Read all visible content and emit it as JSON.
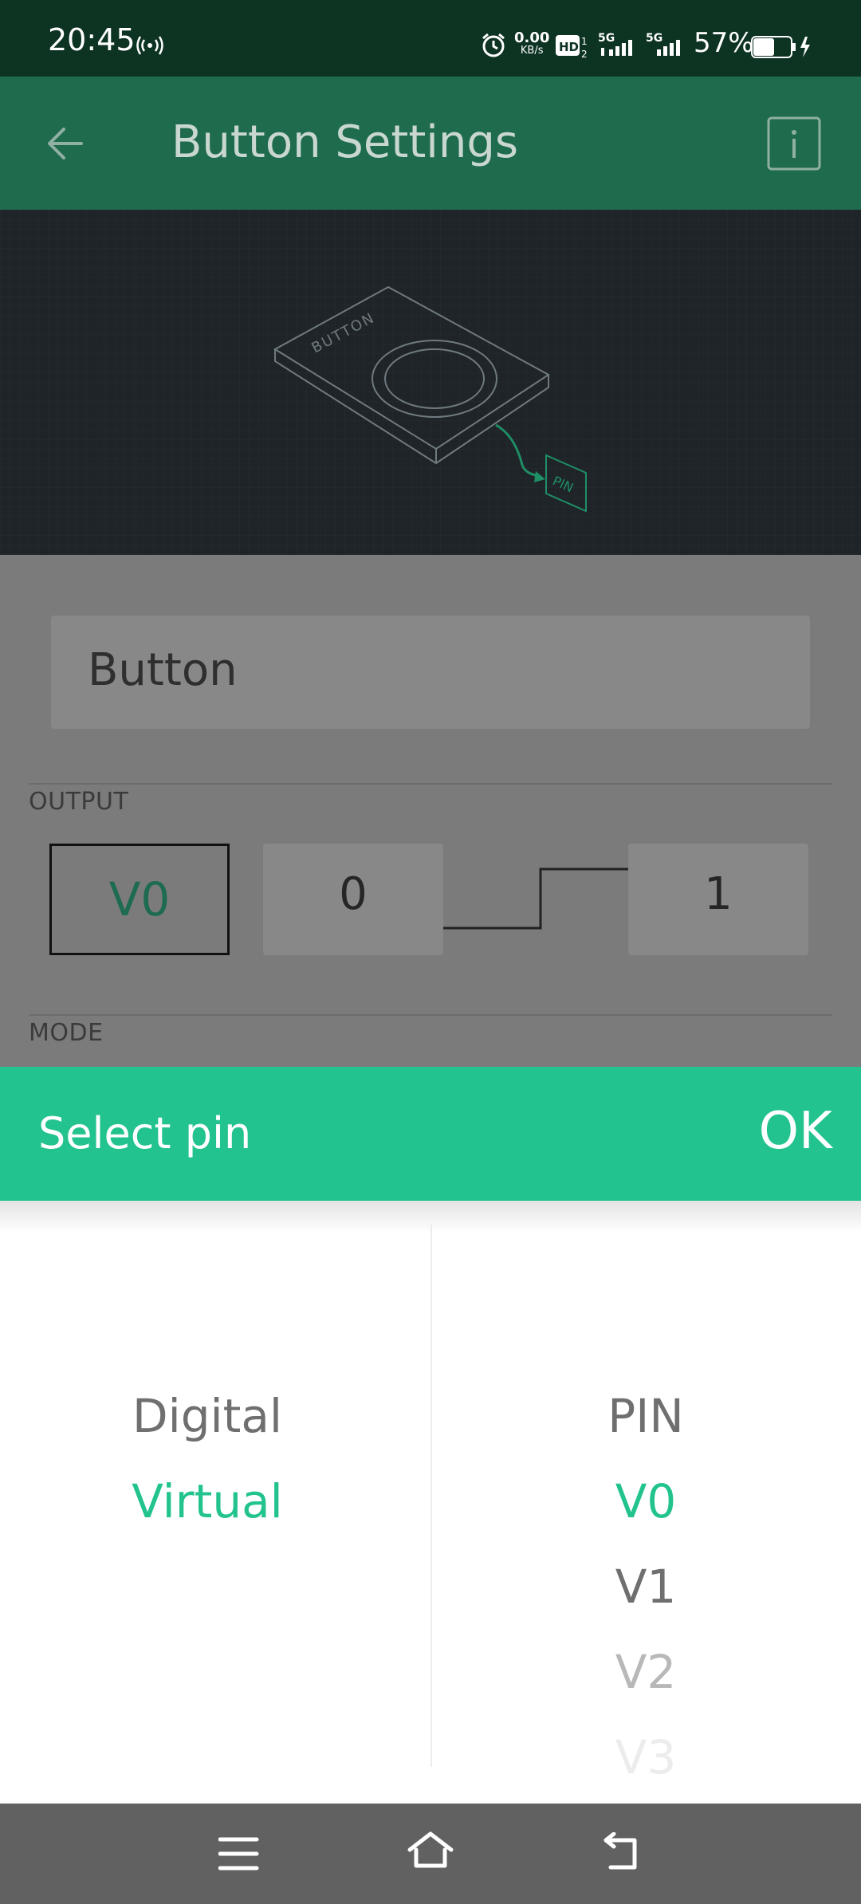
{
  "status_bar": {
    "time": "20:45",
    "net_speed": "0.00",
    "net_unit": "KB/s",
    "battery_percent": "57%",
    "battery_level": 0.57
  },
  "app_bar": {
    "title": "Button Settings"
  },
  "hero": {
    "device_label": "BUTTON",
    "pin_label": "PIN"
  },
  "form": {
    "name_value": "Button",
    "output_label": "OUTPUT",
    "selected_pin": "V0",
    "low_value": "0",
    "high_value": "1",
    "mode_label": "MODE"
  },
  "dialog": {
    "title": "Select pin",
    "ok_label": "OK",
    "pin_types": [
      "Digital",
      "Virtual"
    ],
    "selected_type": "Virtual",
    "pins": [
      "PIN",
      "V0",
      "V1",
      "V2",
      "V3"
    ],
    "selected_pin": "V0"
  },
  "colors": {
    "accent": "#22c38e",
    "app_bar": "#1f6b4d",
    "status_bar": "#0d3322"
  }
}
